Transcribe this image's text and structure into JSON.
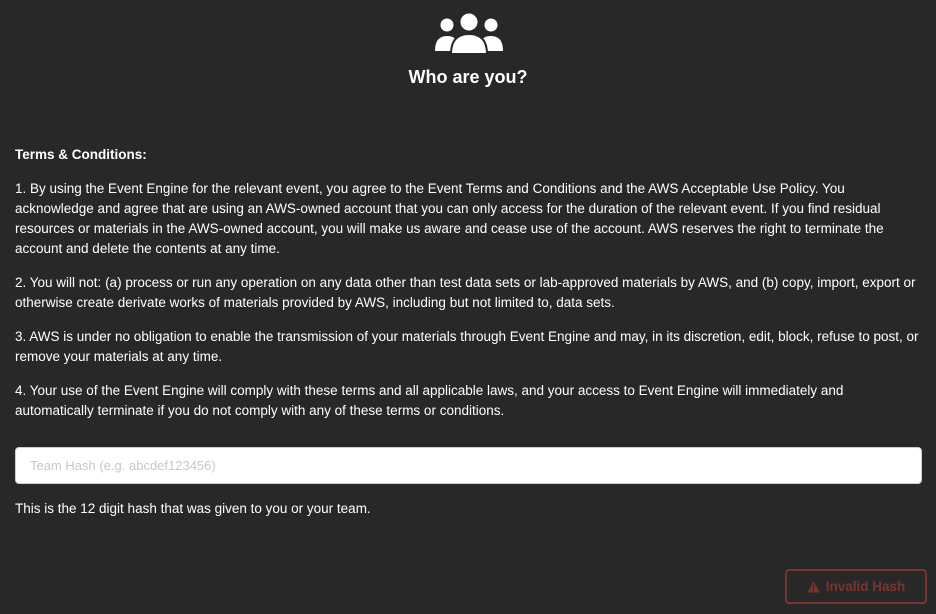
{
  "header": {
    "icon": "users-icon",
    "title": "Who are you?"
  },
  "terms": {
    "heading": "Terms & Conditions:",
    "paragraphs": [
      "1. By using the Event Engine for the relevant event, you agree to the Event Terms and Conditions and the AWS Acceptable Use Policy. You acknowledge and agree that are using an AWS-owned account that you can only access for the duration of the relevant event. If you find residual resources or materials in the AWS-owned account, you will make us aware and cease use of the account. AWS reserves the right to terminate the account and delete the contents at any time.",
      "2. You will not: (a) process or run any operation on any data other than test data sets or lab-approved materials by AWS, and (b) copy, import, export or otherwise create derivate works of materials provided by AWS, including but not limited to, data sets.",
      "3. AWS is under no obligation to enable the transmission of your materials through Event Engine and may, in its discretion, edit, block, refuse to post, or remove your materials at any time.",
      "4. Your use of the Event Engine will comply with these terms and all applicable laws, and your access to Event Engine will immediately and automatically terminate if you do not comply with any of these terms or conditions."
    ]
  },
  "hash_input": {
    "placeholder": "Team Hash (e.g. abcdef123456)",
    "value": ""
  },
  "help_text": "This is the 12 digit hash that was given to you or your team.",
  "submit_button": {
    "icon": "warning-icon",
    "label": "Invalid Hash",
    "color": "#7a3530"
  },
  "colors": {
    "background": "#282828",
    "text": "#ffffff",
    "error": "#7a3530"
  }
}
